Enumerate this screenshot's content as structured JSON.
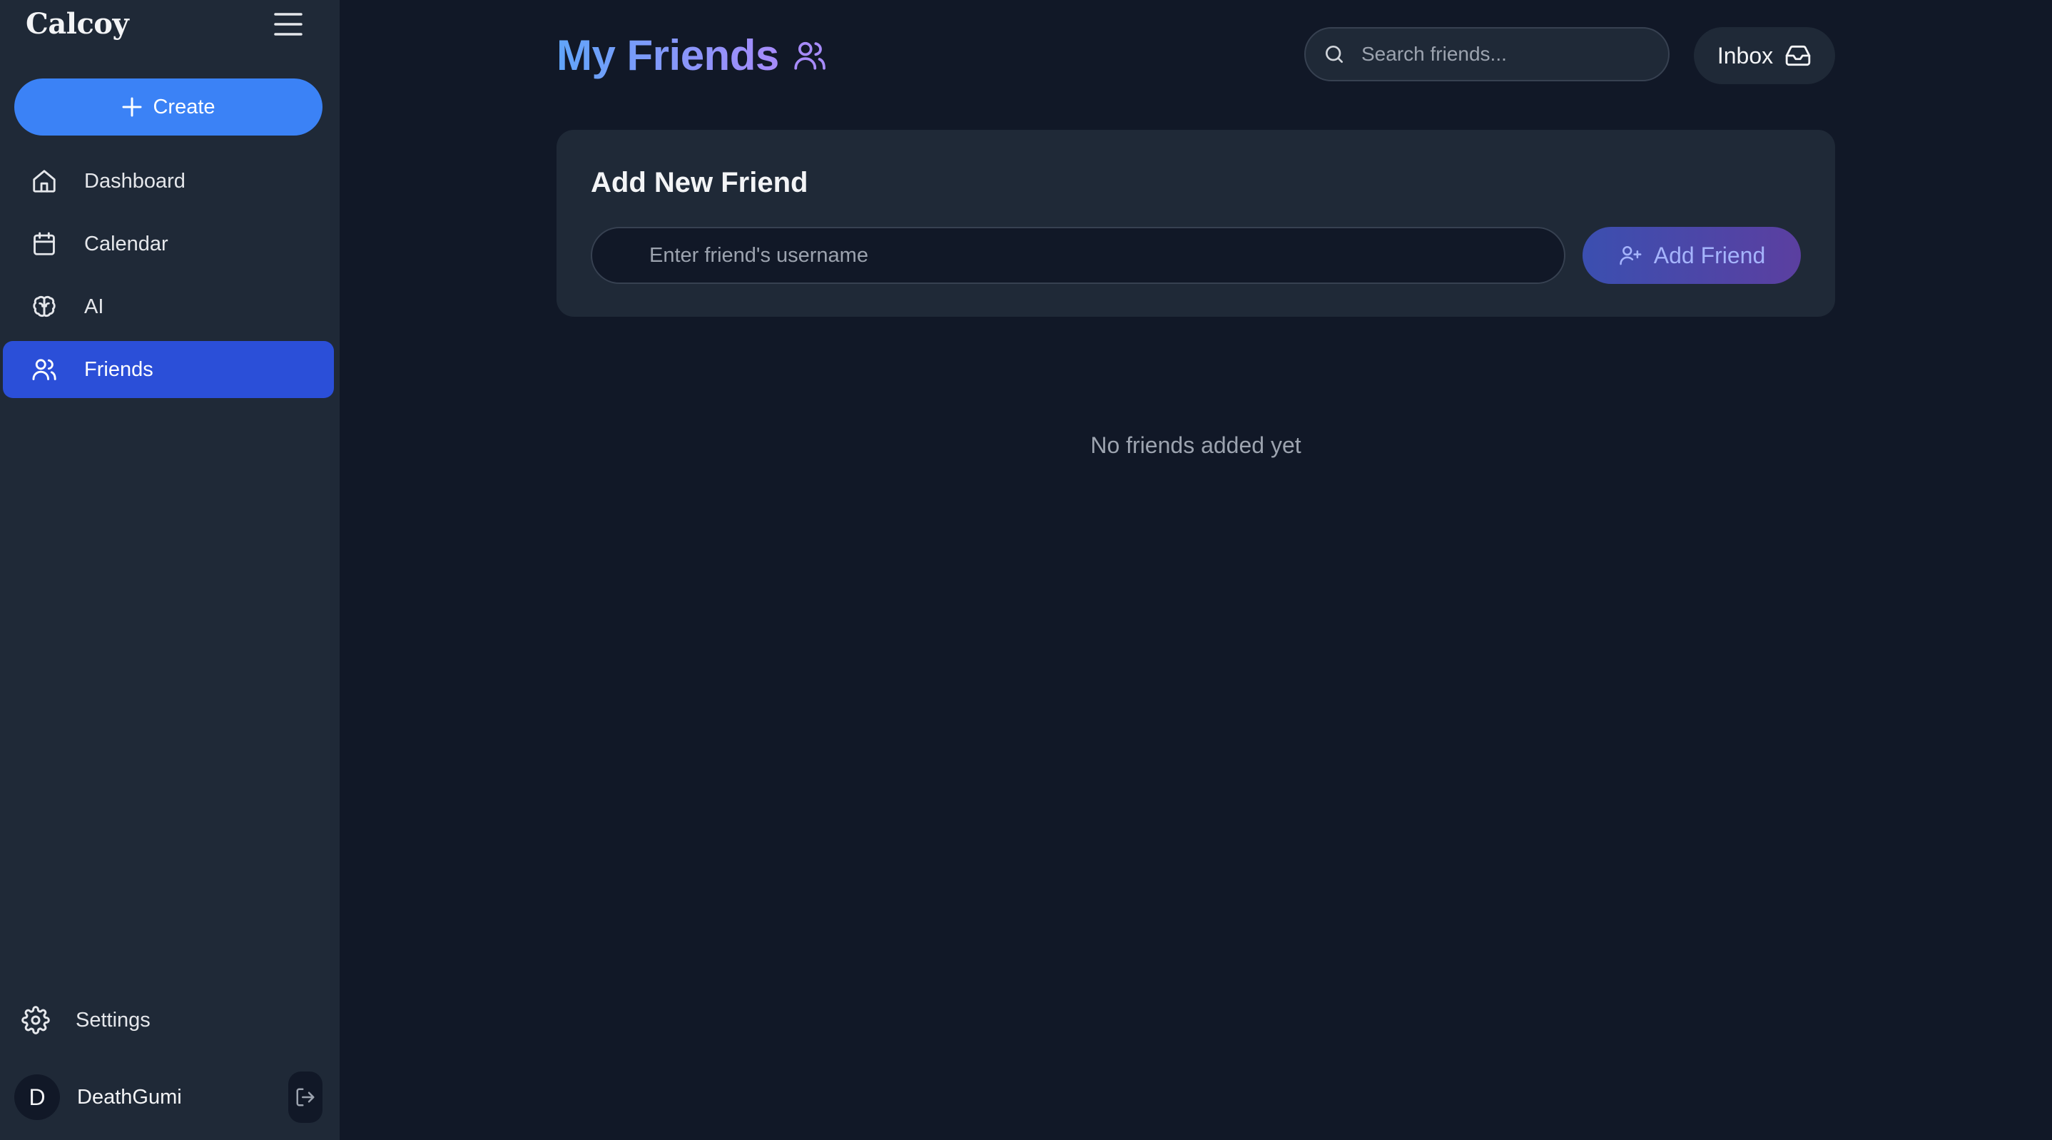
{
  "sidebar": {
    "brand": "Calcoy",
    "create_label": "Create",
    "nav": [
      {
        "label": "Dashboard",
        "icon": "home-icon",
        "active": false
      },
      {
        "label": "Calendar",
        "icon": "calendar-icon",
        "active": false
      },
      {
        "label": "AI",
        "icon": "brain-icon",
        "active": false
      },
      {
        "label": "Friends",
        "icon": "users-icon",
        "active": true
      }
    ],
    "settings_label": "Settings",
    "user": {
      "initial": "D",
      "name": "DeathGumi"
    }
  },
  "header": {
    "title": "My Friends",
    "search_placeholder": "Search friends...",
    "inbox_label": "Inbox"
  },
  "add_friend": {
    "title": "Add New Friend",
    "input_placeholder": "Enter friend's username",
    "button_label": "Add Friend"
  },
  "empty_state": "No friends added yet",
  "colors": {
    "background": "#111827",
    "sidebar": "#1f2937",
    "accent": "#3b82f6",
    "active_nav": "#2b4fd8",
    "title_gradient_start": "#60a5fa",
    "title_gradient_end": "#a78bfa"
  }
}
